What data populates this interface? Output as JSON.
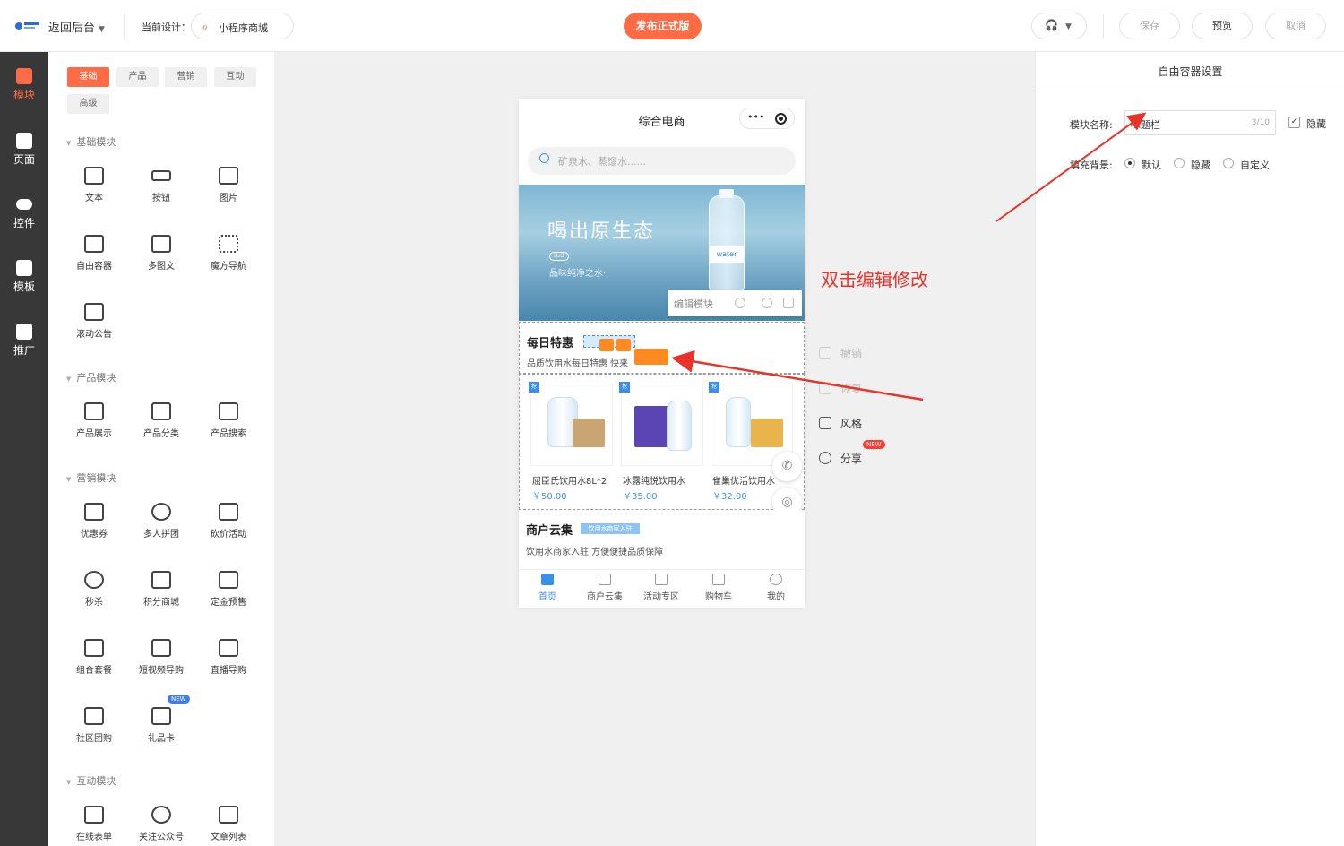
{
  "topbar": {
    "back_label": "返回后台",
    "design_label": "当前设计：",
    "design_name": "小程序商城",
    "publish_label": "发布正式版",
    "save_label": "保存",
    "preview_label": "预览",
    "cancel_label": "取消"
  },
  "leftnav": {
    "items": [
      {
        "label": "模块",
        "icon": "module-icon",
        "active": true
      },
      {
        "label": "页面",
        "icon": "page-icon"
      },
      {
        "label": "控件",
        "icon": "toggle-icon"
      },
      {
        "label": "模板",
        "icon": "template-icon"
      },
      {
        "label": "推广",
        "icon": "megaphone-icon"
      }
    ]
  },
  "panel": {
    "tabs": [
      "基础",
      "产品",
      "营销",
      "互动",
      "高级"
    ],
    "sections": {
      "basic": {
        "title": "基础模块",
        "items": [
          "文本",
          "按钮",
          "图片",
          "自由容器",
          "多图文",
          "魔方导航",
          "滚动公告"
        ]
      },
      "product": {
        "title": "产品模块",
        "items": [
          "产品展示",
          "产品分类",
          "产品搜索"
        ]
      },
      "marketing": {
        "title": "营销模块",
        "items": [
          "优惠券",
          "多人拼团",
          "砍价活动",
          "秒杀",
          "积分商城",
          "定金预售",
          "组合套餐",
          "短视频导购",
          "直播导购",
          "社区团购",
          "礼品卡"
        ],
        "new_badge": "NEW"
      },
      "interactive": {
        "title": "互动模块",
        "items": [
          "在线表单",
          "关注公众号",
          "文章列表"
        ]
      }
    }
  },
  "phone": {
    "title": "综合电商",
    "capsule_dots": "•••",
    "search_placeholder": "矿泉水、蒸馏水......",
    "banner": {
      "headline": "喝出原生态",
      "badge": "H₂O",
      "subline": "品味纯净之水·",
      "bottle_label": "water"
    },
    "edit_bar_label": "编辑模块",
    "section1": {
      "title": "每日特惠",
      "subtitle": "品质饮用水每日特惠 快来"
    },
    "products": [
      {
        "name": "屈臣氏饮用水8L*2",
        "price": "￥50.00"
      },
      {
        "name": "冰露纯悦饮用水",
        "price": "￥35.00"
      },
      {
        "name": "雀巢优活饮用水",
        "price": "￥32.00"
      }
    ],
    "product_badge": "抢",
    "section3": {
      "title": "商户云集",
      "tag": "饮用水商家入驻",
      "subtitle": "饮用水商家入驻 方便便捷品质保障"
    },
    "tabbar": [
      "首页",
      "商户云集",
      "活动专区",
      "购物车",
      "我的"
    ]
  },
  "actions": {
    "undo": "撤销",
    "redo": "恢复",
    "style": "风格",
    "share": "分享",
    "new_badge": "NEW"
  },
  "annotation": "双击编辑修改",
  "rightpanel": {
    "title": "自由容器设置",
    "name_label": "模块名称:",
    "name_value": "标题栏",
    "name_count": "3/10",
    "hide_label": "隐藏",
    "fill_label": "填充背景:",
    "fill_options": [
      "默认",
      "隐藏",
      "自定义"
    ],
    "fill_selected": "默认"
  },
  "colors": {
    "accent": "#ff6b45",
    "nav_bg": "#383838",
    "link_blue": "#3d8fe6",
    "annotation_red": "#e8322a",
    "edit_orange": "#ff8a1f"
  }
}
